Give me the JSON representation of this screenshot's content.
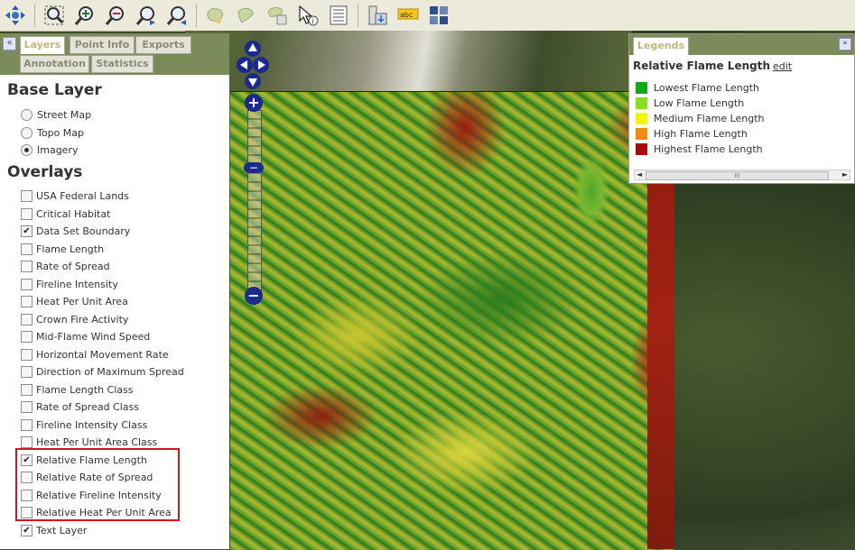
{
  "toolbar": {
    "buttons": [
      "pan-icon",
      "zoom-extent-icon",
      "zoom-in-icon",
      "zoom-out-icon",
      "zoom-previous-icon",
      "zoom-next-icon",
      "select-area-icon",
      "select-shape-icon",
      "select-table-icon",
      "identify-icon",
      "table-icon",
      "export-icon",
      "label-icon",
      "info-icon"
    ],
    "label_text": "abc"
  },
  "panel": {
    "tabs": [
      "Layers",
      "Point Info",
      "Exports",
      "Annotation",
      "Statistics"
    ],
    "base_layer_title": "Base Layer",
    "base_layers": [
      {
        "label": "Street Map",
        "selected": false
      },
      {
        "label": "Topo Map",
        "selected": false
      },
      {
        "label": "Imagery",
        "selected": true
      }
    ],
    "overlays_title": "Overlays",
    "overlays": [
      {
        "label": "USA Federal Lands",
        "checked": false
      },
      {
        "label": "Critical Habitat",
        "checked": false
      },
      {
        "label": "Data Set Boundary",
        "checked": true
      },
      {
        "label": "Flame Length",
        "checked": false
      },
      {
        "label": "Rate of Spread",
        "checked": false
      },
      {
        "label": "Fireline Intensity",
        "checked": false
      },
      {
        "label": "Heat Per Unit Area",
        "checked": false
      },
      {
        "label": "Crown Fire Activity",
        "checked": false
      },
      {
        "label": "Mid-Flame Wind Speed",
        "checked": false
      },
      {
        "label": "Horizontal Movement Rate",
        "checked": false
      },
      {
        "label": "Direction of Maximum Spread",
        "checked": false
      },
      {
        "label": "Flame Length Class",
        "checked": false
      },
      {
        "label": "Rate of Spread Class",
        "checked": false
      },
      {
        "label": "Fireline Intensity Class",
        "checked": false
      },
      {
        "label": "Heat Per Unit Area Class",
        "checked": false
      },
      {
        "label": "Relative Flame Length",
        "checked": true
      },
      {
        "label": "Relative Rate of Spread",
        "checked": false
      },
      {
        "label": "Relative Fireline Intensity",
        "checked": false
      },
      {
        "label": "Relative Heat Per Unit Area",
        "checked": false
      },
      {
        "label": "Text Layer",
        "checked": true
      }
    ],
    "collapse_glyph": "«"
  },
  "legend": {
    "tab": "Legends",
    "expand_glyph": "»",
    "title": "Relative Flame Length",
    "edit": "edit",
    "items": [
      {
        "label": "Lowest Flame Length",
        "color": "#11a81a"
      },
      {
        "label": "Low Flame Length",
        "color": "#86e020"
      },
      {
        "label": "Medium Flame Length",
        "color": "#f6f500"
      },
      {
        "label": "High Flame Length",
        "color": "#f28a10"
      },
      {
        "label": "Highest Flame Length",
        "color": "#a80b0b"
      }
    ],
    "scroll_left": "◄",
    "scroll_right": "►",
    "scroll_thumb": "III"
  },
  "map": {
    "zoom_in": "+",
    "zoom_out": "−",
    "slider": "−"
  }
}
